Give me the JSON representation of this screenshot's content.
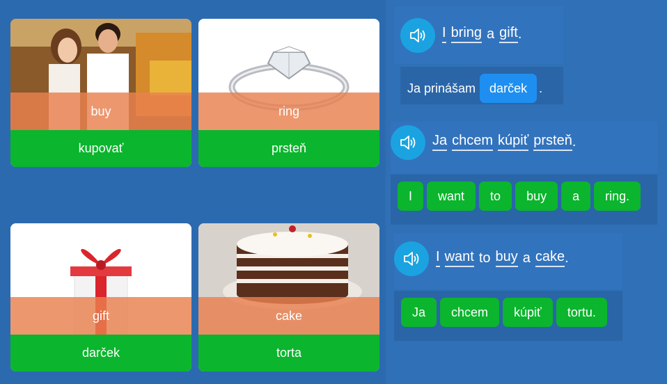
{
  "cards": [
    {
      "en": "buy",
      "sk": "kupovať",
      "icon": "shopping-couple-photo"
    },
    {
      "en": "ring",
      "sk": "prsteň",
      "icon": "ring-photo"
    },
    {
      "en": "gift",
      "sk": "darček",
      "icon": "gift-photo"
    },
    {
      "en": "cake",
      "sk": "torta",
      "icon": "cake-photo"
    }
  ],
  "sentence1": {
    "prompt_words": [
      "I",
      "bring",
      "a",
      "gift",
      "."
    ],
    "answer_prefix": "Ja prinášam",
    "answer_chip": "darček",
    "answer_suffix": "."
  },
  "sentence2": {
    "prompt_words": [
      "Ja",
      "chcem",
      "kúpiť",
      "prsteň",
      "."
    ],
    "chips": [
      "I",
      "want",
      "to",
      "buy",
      "a",
      "ring."
    ]
  },
  "sentence3": {
    "prompt_words": [
      "I",
      "want",
      "to",
      "buy",
      "a",
      "cake",
      "."
    ],
    "chips": [
      "Ja",
      "chcem",
      "kúpiť",
      "tortu."
    ]
  },
  "colors": {
    "accent_green": "#0bb52d",
    "accent_orange": "#e9804f",
    "speaker_blue": "#1aa3e0",
    "chip_blue": "#1e8ff0"
  }
}
